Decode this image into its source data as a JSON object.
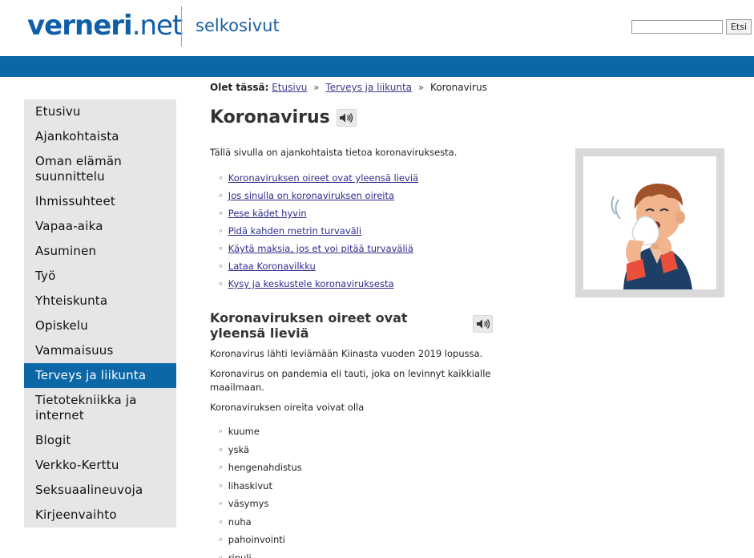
{
  "header": {
    "logo_part1": "verneri",
    "logo_part2": ".net",
    "subtitle": "selkosivut",
    "search_placeholder": "",
    "search_button": "Etsi"
  },
  "breadcrumb": {
    "prefix": "Olet tässä:",
    "items": [
      "Etusivu",
      "Terveys ja liikunta"
    ],
    "current": "Koronavirus",
    "separator": "»"
  },
  "sidebar": {
    "items": [
      {
        "label": "Etusivu",
        "active": false
      },
      {
        "label": "Ajankohtaista",
        "active": false
      },
      {
        "label": "Oman elämän suunnittelu",
        "active": false
      },
      {
        "label": "Ihmissuhteet",
        "active": false
      },
      {
        "label": "Vapaa-aika",
        "active": false
      },
      {
        "label": "Asuminen",
        "active": false
      },
      {
        "label": "Työ",
        "active": false
      },
      {
        "label": "Yhteiskunta",
        "active": false
      },
      {
        "label": "Opiskelu",
        "active": false
      },
      {
        "label": "Vammaisuus",
        "active": false
      },
      {
        "label": "Terveys ja liikunta",
        "active": true
      },
      {
        "label": "Tietotekniikka ja internet",
        "active": false
      },
      {
        "label": "Blogit",
        "active": false
      },
      {
        "label": "Verkko-Kerttu",
        "active": false
      },
      {
        "label": "Seksuaalineuvoja",
        "active": false
      },
      {
        "label": "Kirjeenvaihto",
        "active": false
      }
    ]
  },
  "main": {
    "title": "Koronavirus",
    "intro": "Tällä sivulla on ajankohtaista tietoa koronaviruksesta.",
    "toc": [
      "Koronaviruksen oireet ovat yleensä lieviä",
      "Jos sinulla on koronaviruksen oireita",
      "Pese kädet hyvin",
      "Pidä kahden metrin turvaväli",
      "Käytä maksia, jos et voi pitää turvaväliä",
      "Lataa Koronavilkku",
      "Kysy ja keskustele koronaviruksesta"
    ],
    "section1": {
      "heading": "Koronaviruksen oireet ovat yleensä lieviä",
      "p1": "Koronavirus lähti leviämään Kiinasta vuoden 2019 lopussa.",
      "p2": "Koronavirus on pandemia eli tauti, joka on levinnyt kaikkialle maailmaan.",
      "p3": "Koronaviruksen oireita voivat olla",
      "symptoms": [
        "kuume",
        "yskä",
        "hengenahdistus",
        "lihaskivut",
        "väsymys",
        "nuha",
        "pahoinvointi",
        "ripuli."
      ]
    }
  },
  "colors": {
    "brand_blue": "#0b67a6",
    "sidebar_bg": "#e6e6e6",
    "link": "#2b2b8f"
  }
}
